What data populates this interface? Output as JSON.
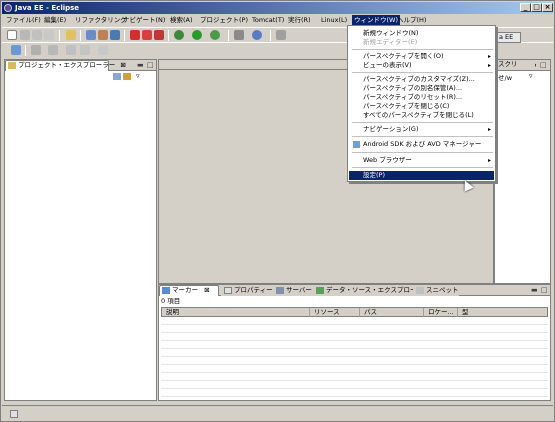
{
  "window": {
    "title": "Java EE - Eclipse",
    "min_glyph": "_",
    "max_glyph": "□",
    "close_glyph": "×"
  },
  "menubar": {
    "items": [
      {
        "label": "ファイル(F)"
      },
      {
        "label": "編集(E)"
      },
      {
        "label": "リファクタリング"
      },
      {
        "label": "ナビゲート(N)"
      },
      {
        "label": "検索(A)"
      },
      {
        "label": "プロジェクト(P)"
      },
      {
        "label": "Tomcat(T)"
      },
      {
        "label": "実行(R)"
      },
      {
        "label": "Linux(L)"
      },
      {
        "label": "ウィンドウ(W)"
      },
      {
        "label": "ヘルプ(H)"
      }
    ],
    "active_index": 9
  },
  "perspective": {
    "label": "a EE",
    "other_label": "スクリ"
  },
  "project_explorer": {
    "tab_label": "プロジェクト・エクスプローラー"
  },
  "outline": {
    "partial_text": "せ/w"
  },
  "window_menu": {
    "items": [
      {
        "label": "新規ウィンドウ(N)",
        "disabled": false
      },
      {
        "label": "新規エディター(E)",
        "disabled": true
      },
      {
        "label": "パースペクティブを開く(O)",
        "submenu": true
      },
      {
        "label": "ビューの表示(V)",
        "submenu": true
      },
      {
        "label": "パースペクティブのカスタマイズ(Z)..."
      },
      {
        "label": "パースペクティブの別名保管(A)..."
      },
      {
        "label": "パースペクティブのリセット(R)..."
      },
      {
        "label": "パースペクティブを閉じる(C)"
      },
      {
        "label": "すべてのパースペクティブを閉じる(L)"
      },
      {
        "label": "ナビゲーション(G)",
        "submenu": true
      },
      {
        "label": "Android SDK および AVD マネージャー"
      },
      {
        "label": "Web ブラウザー",
        "submenu": true
      },
      {
        "label": "設定(P)",
        "selected": true
      }
    ],
    "submenu_arrow": "▸"
  },
  "bottom_panel": {
    "tabs": [
      {
        "label": "マーカー"
      },
      {
        "label": "プロパティー"
      },
      {
        "label": "サーバー"
      },
      {
        "label": "データ・ソース・エクスプローラー"
      },
      {
        "label": "スニペット"
      }
    ],
    "item_count": "0 項目",
    "columns": [
      "説明",
      "リソース",
      "パス",
      "ロケー...",
      "型"
    ]
  },
  "colors": {
    "title_gradient_start": "#0a246a",
    "title_gradient_end": "#a6caf0",
    "chrome": "#d4d0c8",
    "selection": "#0a246a"
  }
}
